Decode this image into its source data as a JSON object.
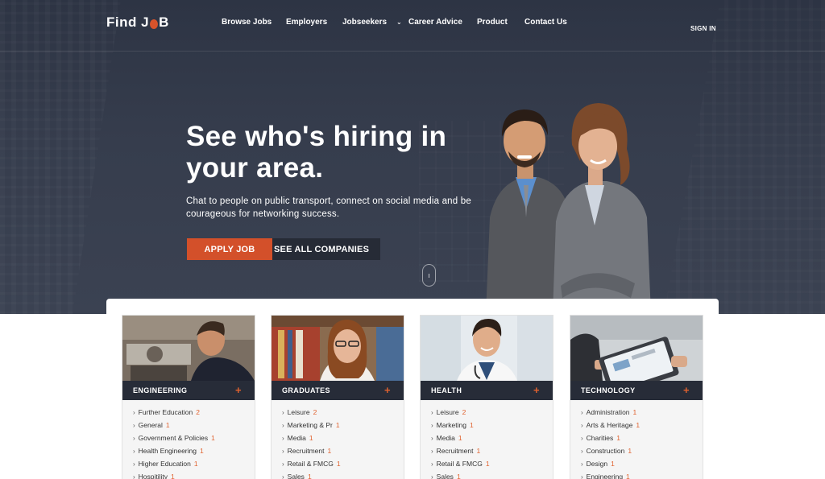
{
  "header": {
    "logo_text_left": "Find J",
    "logo_text_right": "B",
    "nav": [
      {
        "label": "Browse Jobs"
      },
      {
        "label": "Employers"
      },
      {
        "label": "Jobseekers"
      },
      {
        "label": "Career Advice"
      },
      {
        "label": "Product"
      },
      {
        "label": "Contact Us"
      }
    ],
    "signin_label": "SIGN IN"
  },
  "hero": {
    "headline": "See who's hiring in your area.",
    "subtext": "Chat to people on public transport, connect on social media and be courageous for networking success.",
    "apply_label": "APPLY JOB",
    "companies_label": "SEE ALL COMPANIES"
  },
  "categories": [
    {
      "title": "ENGINEERING",
      "items": [
        {
          "label": "Further Education",
          "count": "2"
        },
        {
          "label": "General",
          "count": "1"
        },
        {
          "label": "Government & Policies",
          "count": "1"
        },
        {
          "label": "Health Engineering",
          "count": "1"
        },
        {
          "label": "Higher Education",
          "count": "1"
        },
        {
          "label": "Hospitility",
          "count": "1"
        }
      ]
    },
    {
      "title": "GRADUATES",
      "items": [
        {
          "label": "Leisure",
          "count": "2"
        },
        {
          "label": "Marketing & Pr",
          "count": "1"
        },
        {
          "label": "Media",
          "count": "1"
        },
        {
          "label": "Recruitment",
          "count": "1"
        },
        {
          "label": "Retail & FMCG",
          "count": "1"
        },
        {
          "label": "Sales",
          "count": "1"
        }
      ]
    },
    {
      "title": "HEALTH",
      "items": [
        {
          "label": "Leisure",
          "count": "2"
        },
        {
          "label": "Marketing",
          "count": "1"
        },
        {
          "label": "Media",
          "count": "1"
        },
        {
          "label": "Recruitment",
          "count": "1"
        },
        {
          "label": "Retail & FMCG",
          "count": "1"
        },
        {
          "label": "Sales",
          "count": "1"
        }
      ]
    },
    {
      "title": "TECHNOLOGY",
      "items": [
        {
          "label": "Administration",
          "count": "1"
        },
        {
          "label": "Arts & Heritage",
          "count": "1"
        },
        {
          "label": "Charities",
          "count": "1"
        },
        {
          "label": "Construction",
          "count": "1"
        },
        {
          "label": "Design",
          "count": "1"
        },
        {
          "label": "Engineering",
          "count": "1"
        }
      ]
    }
  ],
  "colors": {
    "accent": "#d3502a",
    "hero_bg": "#343b4b",
    "card_header_bg": "#272c38"
  }
}
